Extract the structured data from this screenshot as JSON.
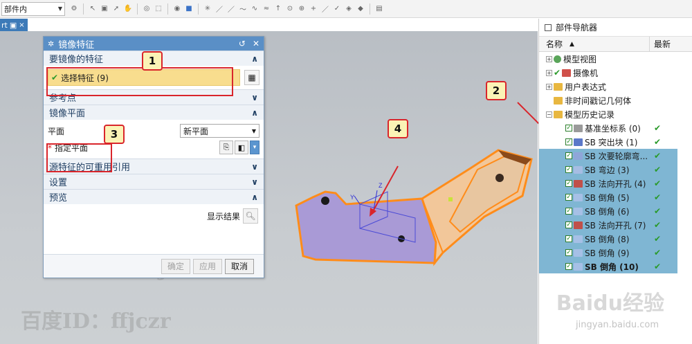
{
  "toolbar": {
    "filter": "部件内"
  },
  "tab": {
    "label": "rt",
    "close": "×"
  },
  "dialog": {
    "title": "镜像特征",
    "reset": "↺",
    "close": "✕",
    "sections": {
      "features": "要镜像的特征",
      "reference": "参考点",
      "plane": "镜像平面",
      "reuse": "源特征的可重用引用",
      "settings": "设置",
      "preview": "预览"
    },
    "select_features": "选择特征 (9)",
    "plane_label": "平面",
    "plane_option": "新平面",
    "specify_plane": "指定平面",
    "show_result": "显示结果",
    "buttons": {
      "ok": "确定",
      "apply": "应用",
      "cancel": "取消"
    }
  },
  "callouts": [
    "1",
    "2",
    "3",
    "4"
  ],
  "watermark": "百度ID：ffjczr",
  "navigator": {
    "title": "部件导航器",
    "col_name": "名称",
    "col_latest": "最新",
    "items": [
      {
        "label": "模型视图",
        "latest": ""
      },
      {
        "label": "摄像机",
        "latest": ""
      },
      {
        "label": "用户表达式",
        "latest": ""
      },
      {
        "label": "非时间戳记几何体",
        "latest": ""
      },
      {
        "label": "模型历史记录",
        "latest": ""
      },
      {
        "label": "基准坐标系 (0)",
        "latest": "✔"
      },
      {
        "label": "SB 突出块 (1)",
        "latest": "✔"
      },
      {
        "label": "SB 次要轮廓弯...",
        "latest": "✔"
      },
      {
        "label": "SB 弯边 (3)",
        "latest": "✔"
      },
      {
        "label": "SB 法向开孔 (4)",
        "latest": "✔"
      },
      {
        "label": "SB 倒角 (5)",
        "latest": "✔"
      },
      {
        "label": "SB 倒角 (6)",
        "latest": "✔"
      },
      {
        "label": "SB 法向开孔 (7)",
        "latest": "✔"
      },
      {
        "label": "SB 倒角 (8)",
        "latest": "✔"
      },
      {
        "label": "SB 倒角 (9)",
        "latest": "✔"
      },
      {
        "label": "SB 倒角 (10)",
        "latest": "✔"
      }
    ]
  },
  "baidu": {
    "logo": "Baidu经验",
    "url": "jingyan.baidu.com"
  }
}
